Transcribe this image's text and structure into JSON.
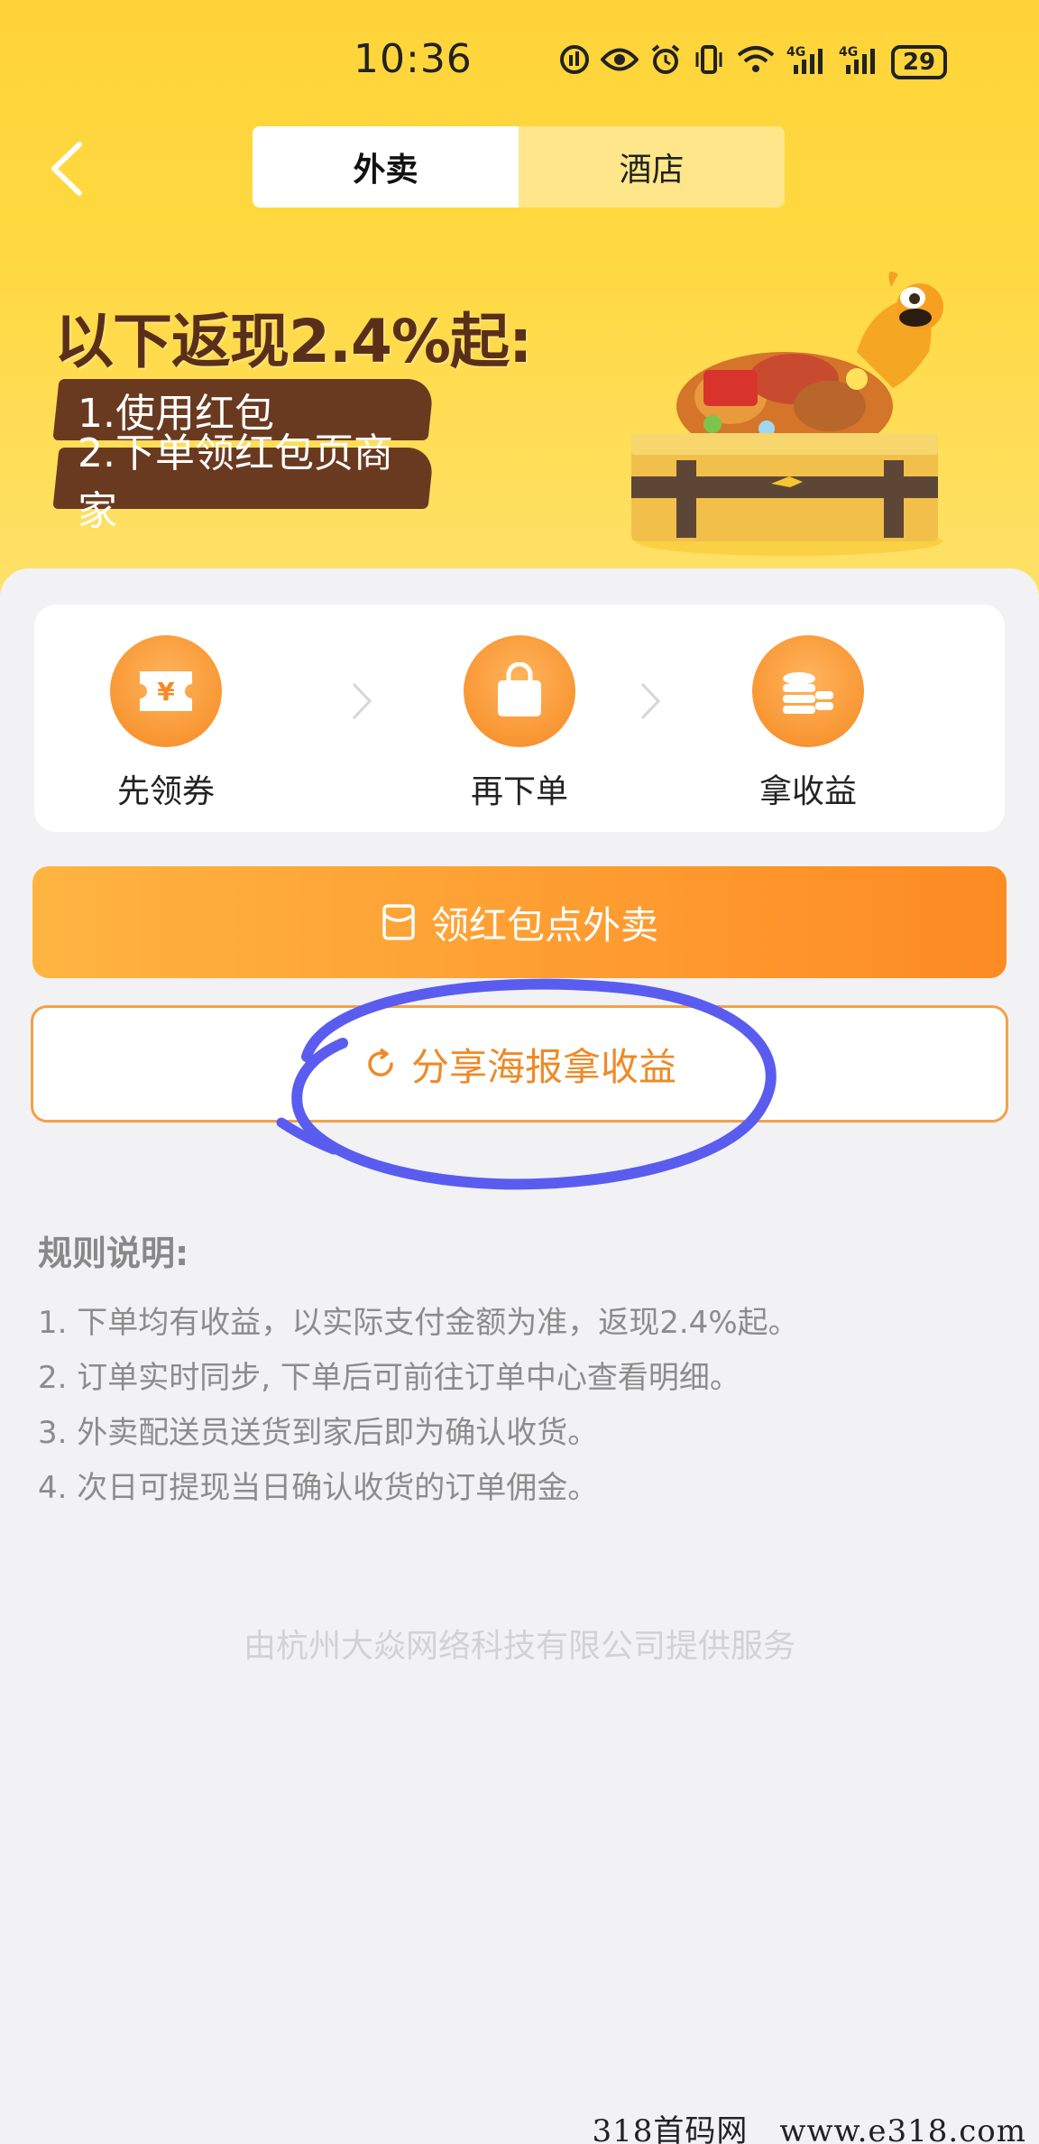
{
  "status_bar": {
    "time": "10:36",
    "battery": "29",
    "icons": [
      "signal-badge-icon",
      "eye-icon",
      "alarm-icon",
      "vibrate-icon",
      "wifi-icon",
      "4g-signal-icon",
      "4g-signal-icon"
    ],
    "network_labels": [
      "4G",
      "4G"
    ]
  },
  "nav": {
    "tabs": [
      {
        "label": "外卖",
        "active": true
      },
      {
        "label": "酒店",
        "active": false
      }
    ]
  },
  "banner": {
    "title": "以下返现2.4%起:",
    "items": [
      "1.使用红包",
      "2.下单领红包页商家"
    ]
  },
  "steps": [
    {
      "label": "先领券",
      "icon": "coupon-icon"
    },
    {
      "label": "再下单",
      "icon": "shopping-bag-icon"
    },
    {
      "label": "拿收益",
      "icon": "coins-icon"
    }
  ],
  "buttons": {
    "primary_label": "领红包点外卖",
    "secondary_label": "分享海报拿收益"
  },
  "rules": {
    "title": "规则说明:",
    "items": [
      "1. 下单均有收益，以实际支付金额为准，返现2.4%起。",
      "2. 订单实时同步, 下单后可前往订单中心查看明细。",
      "3. 外卖配送员送货到家后即为确认收货。",
      "4. 次日可提现当日确认收货的订单佣金。"
    ]
  },
  "provider": "由杭州大焱网络科技有限公司提供服务",
  "watermark": "318首码网　www.e318.com",
  "colors": {
    "header_yellow": "#ffd43a",
    "accent_orange": "#fd8b24",
    "annotation_blue": "#5a5cf0"
  }
}
